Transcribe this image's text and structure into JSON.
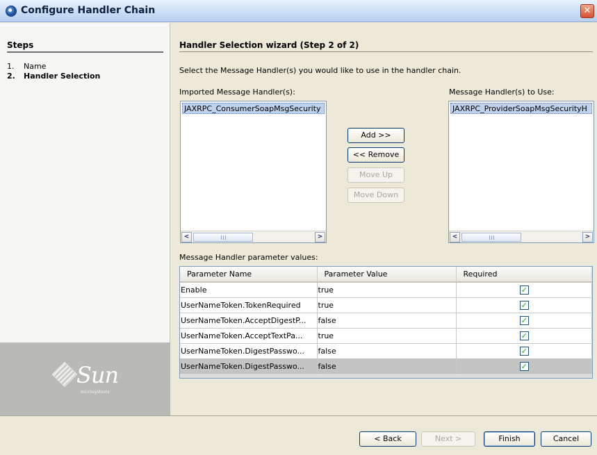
{
  "window": {
    "title": "Configure Handler Chain"
  },
  "steps": {
    "title": "Steps",
    "items": [
      {
        "num": "1.",
        "label": "Name"
      },
      {
        "num": "2.",
        "label": "Handler Selection"
      }
    ]
  },
  "brand": {
    "name": "Sun",
    "sub": "microsystems"
  },
  "wizard": {
    "heading": "Handler Selection wizard (Step 2 of 2)",
    "instruction": "Select the Message Handler(s) you would like to use in the handler chain."
  },
  "imported": {
    "label": "Imported Message Handler(s):",
    "items": [
      "JAXRPC_ConsumerSoapMsgSecurity"
    ]
  },
  "to_use": {
    "label": "Message Handler(s) to Use:",
    "items": [
      "JAXRPC_ProviderSoapMsgSecurityH"
    ]
  },
  "buttons": {
    "add": "Add >>",
    "remove": "<< Remove",
    "move_up": "Move Up",
    "move_down": "Move Down"
  },
  "params": {
    "label": "Message Handler parameter values:",
    "columns": [
      "Parameter Name",
      "Parameter Value",
      "Required"
    ],
    "rows": [
      {
        "name": "Enable",
        "value": "true",
        "required": true
      },
      {
        "name": "UserNameToken.TokenRequired",
        "value": "true",
        "required": true
      },
      {
        "name": "UserNameToken.AcceptDigestP...",
        "value": "false",
        "required": true
      },
      {
        "name": "UserNameToken.AcceptTextPa...",
        "value": "true",
        "required": true
      },
      {
        "name": "UserNameToken.DigestPasswo...",
        "value": "false",
        "required": true
      },
      {
        "name": "UserNameToken.DigestPasswo...",
        "value": "false",
        "required": true
      }
    ],
    "selected_row": 6
  },
  "footer": {
    "back": "< Back",
    "next": "Next >",
    "finish": "Finish",
    "cancel": "Cancel"
  },
  "icons": {
    "window": "window-icon",
    "close": "close-icon",
    "check": "check-icon"
  }
}
